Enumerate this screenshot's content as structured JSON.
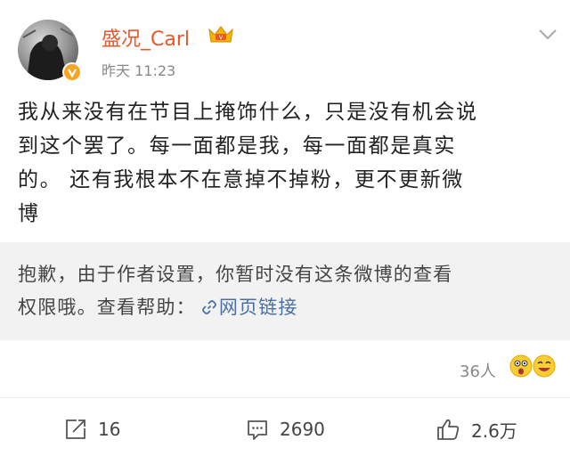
{
  "post": {
    "username": "盛况_Carl",
    "time": "昨天 11:23",
    "content_lines": [
      "我从来没有在节目上掩饰什么，只是没有机会说",
      "到这个罢了。每一面都是我，每一面都是真实",
      "的。 还有我根本不在意掉不掉粉，更不更新微",
      "博"
    ]
  },
  "notice": {
    "line1": "抱歉，由于作者设置，你暂时没有这条微博的查看",
    "line2_prefix": "权限哦。查看帮助：",
    "link_label": "网页链接"
  },
  "reactions": {
    "count": "36人"
  },
  "actions": {
    "repost_count": "16",
    "comment_count": "2690",
    "like_count": "2.6万"
  },
  "icons": {
    "verified": "verified-badge-icon",
    "crown": "member-crown-icon",
    "chevron": "chevron-down-icon",
    "link": "link-icon",
    "repost": "repost-icon",
    "comment": "comment-icon",
    "like": "thumbs-up-icon"
  },
  "colors": {
    "username": "#e8562a",
    "link": "#4a6fa5",
    "badge": "#f5a623"
  }
}
